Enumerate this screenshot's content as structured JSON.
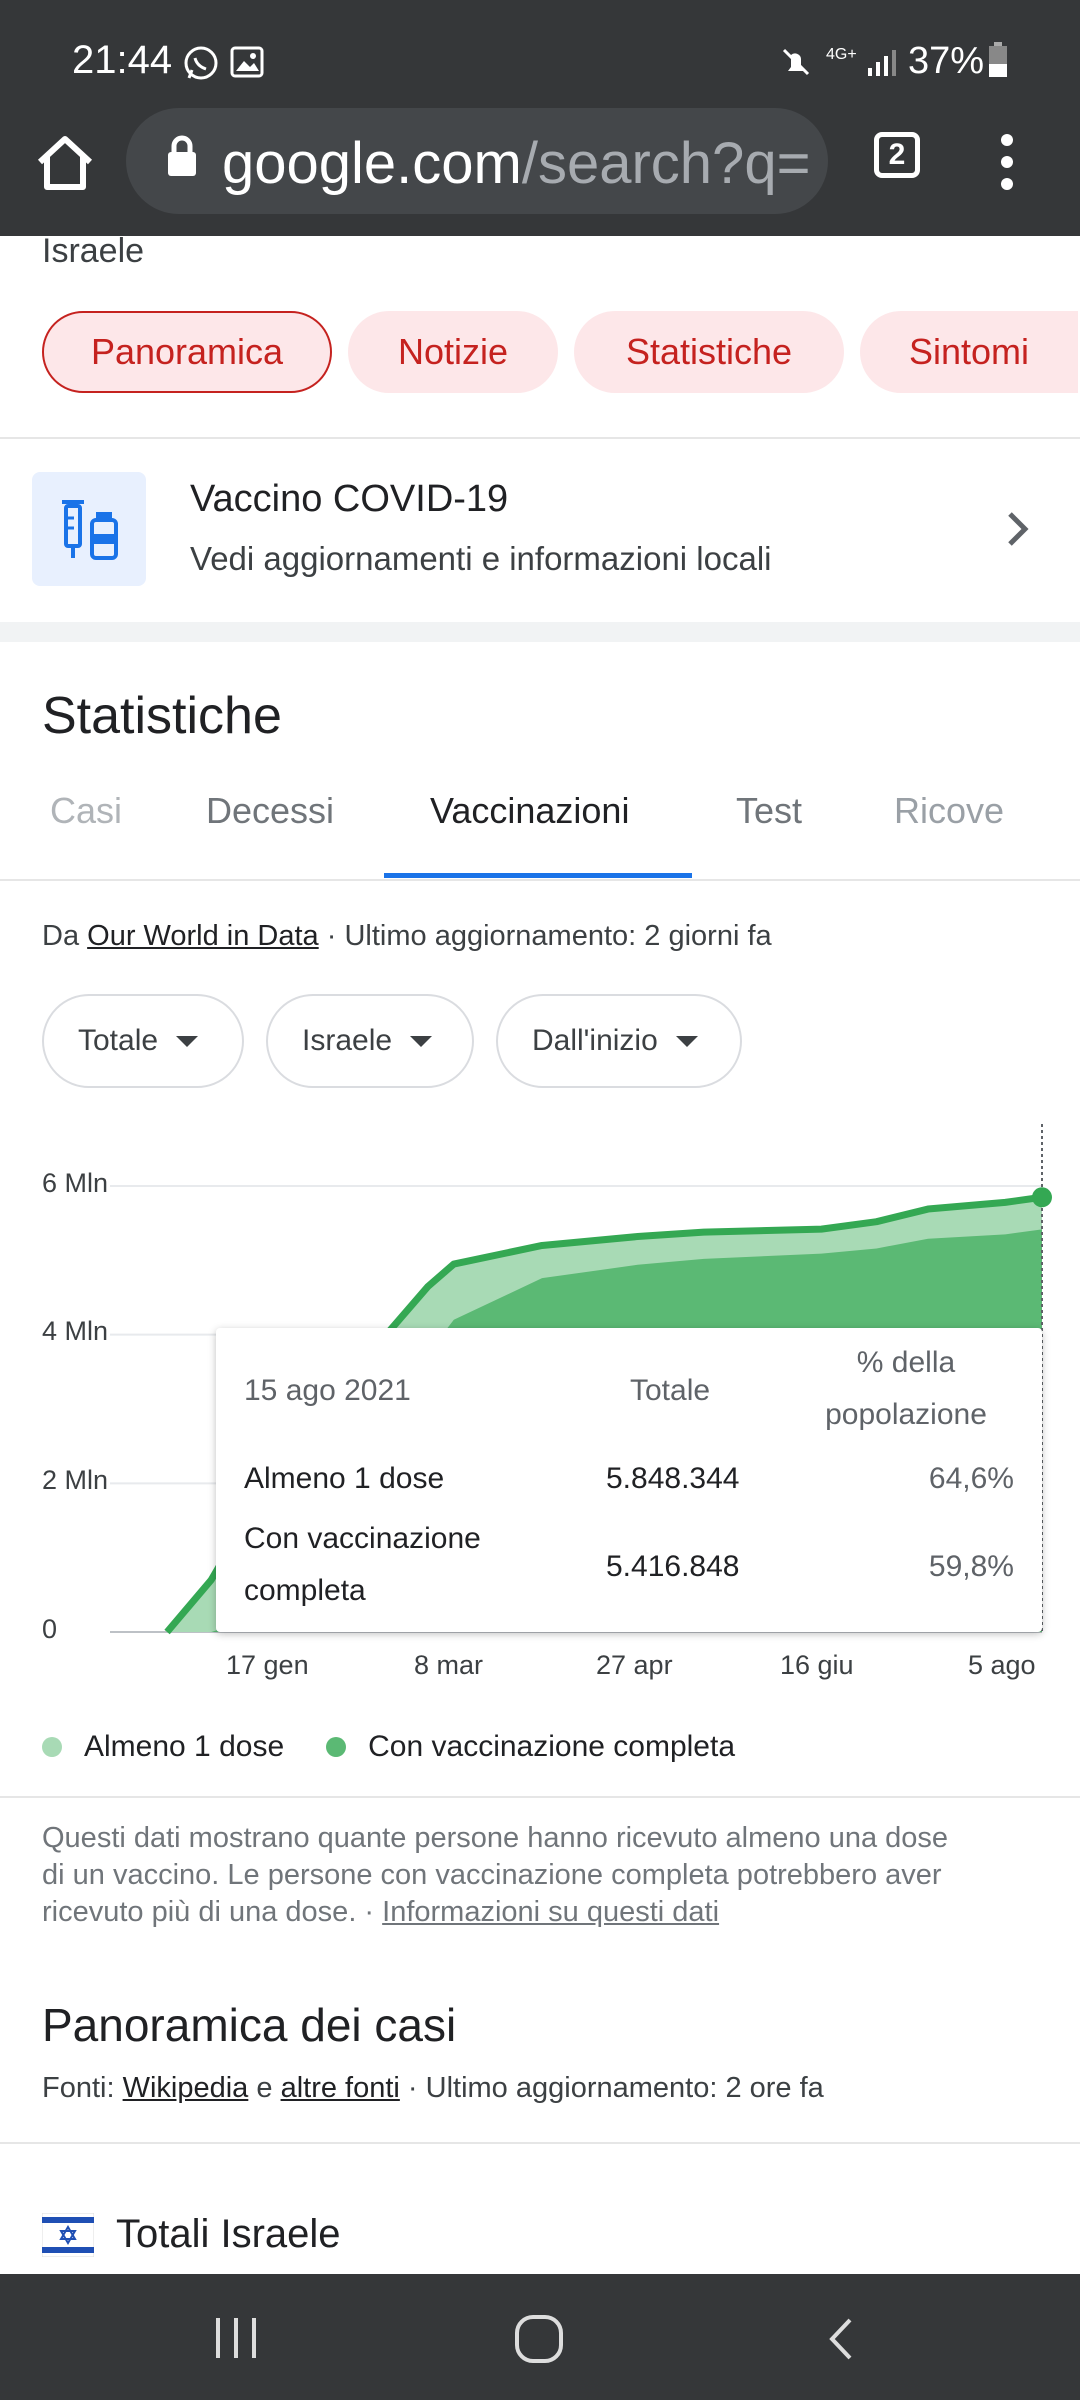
{
  "status_bar": {
    "time": "21:44",
    "battery": "37%",
    "network": "4G+"
  },
  "toolbar": {
    "url_host": "google.com",
    "url_path": "/search?q=is",
    "tab_count": "2"
  },
  "top_partial_title": "Israele",
  "chips": [
    {
      "label": "Panoramica",
      "active": true
    },
    {
      "label": "Notizie",
      "active": false
    },
    {
      "label": "Statistiche",
      "active": false
    },
    {
      "label": "Sintomi",
      "active": false
    }
  ],
  "vaccine_card": {
    "title": "Vaccino COVID-19",
    "subtitle": "Vedi aggiornamenti e informazioni locali"
  },
  "stats": {
    "heading": "Statistiche",
    "tabs": [
      "Casi",
      "Decessi",
      "Vaccinazioni",
      "Test",
      "Ricove"
    ],
    "active_tab": 2,
    "source_prefix": "Da ",
    "source_link": "Our World in Data",
    "source_suffix": " · Ultimo aggiornamento: 2 giorni fa",
    "filters": [
      "Totale",
      "Israele",
      "Dall'inizio"
    ]
  },
  "chart_data": {
    "type": "area",
    "y_ticks": [
      "6 Mln",
      "4 Mln",
      "2 Mln",
      "0"
    ],
    "ylim": [
      0,
      6000000
    ],
    "x_ticks": [
      "17 gen",
      "8 mar",
      "27 apr",
      "16 giu",
      "5 ago"
    ],
    "x": [
      "2020-12-20",
      "2021-01-01",
      "2021-01-17",
      "2021-02-01",
      "2021-02-15",
      "2021-03-01",
      "2021-03-08",
      "2021-04-01",
      "2021-04-27",
      "2021-05-15",
      "2021-06-16",
      "2021-07-01",
      "2021-07-15",
      "2021-08-05",
      "2021-08-15"
    ],
    "series": [
      {
        "name": "Almeno 1 dose",
        "color": "#a8dab5",
        "values": [
          0,
          700000,
          2050000,
          3050000,
          3850000,
          4650000,
          4950000,
          5200000,
          5320000,
          5380000,
          5420000,
          5520000,
          5690000,
          5780000,
          5848344
        ]
      },
      {
        "name": "Con vaccinazione completa",
        "color": "#5bb974",
        "values": [
          0,
          0,
          250000,
          1200000,
          2600000,
          3750000,
          4200000,
          4760000,
          4940000,
          5020000,
          5090000,
          5160000,
          5290000,
          5350000,
          5416848
        ]
      }
    ],
    "line_color": "#34a853",
    "tooltip": {
      "date": "15 ago 2021",
      "col_total": "Totale",
      "col_pct_line1": "% della",
      "col_pct_line2": "popolazione",
      "rows": [
        {
          "label_line1": "Almeno 1 dose",
          "label_line2": "",
          "total": "5.848.344",
          "pct": "64,6%"
        },
        {
          "label_line1": "Con vaccinazione",
          "label_line2": "completa",
          "total": "5.416.848",
          "pct": "59,8%"
        }
      ]
    },
    "legend": [
      "Almeno 1 dose",
      "Con vaccinazione completa"
    ]
  },
  "notes": {
    "line1": "Questi dati mostrano quante persone hanno ricevuto almeno una dose",
    "line2": "di un vaccino. Le persone con vaccinazione completa potrebbero aver",
    "line3": "ricevuto più di una dose.",
    "sep": " · ",
    "link": "Informazioni su questi dati"
  },
  "cases_overview": {
    "title": "Panoramica dei casi",
    "src_prefix": "Fonti: ",
    "src_link1": "Wikipedia",
    "src_mid": " e ",
    "src_link2": "altre fonti",
    "src_suffix": " · Ultimo aggiornamento: 2 ore fa"
  },
  "totals": {
    "title": "Totali Israele"
  }
}
